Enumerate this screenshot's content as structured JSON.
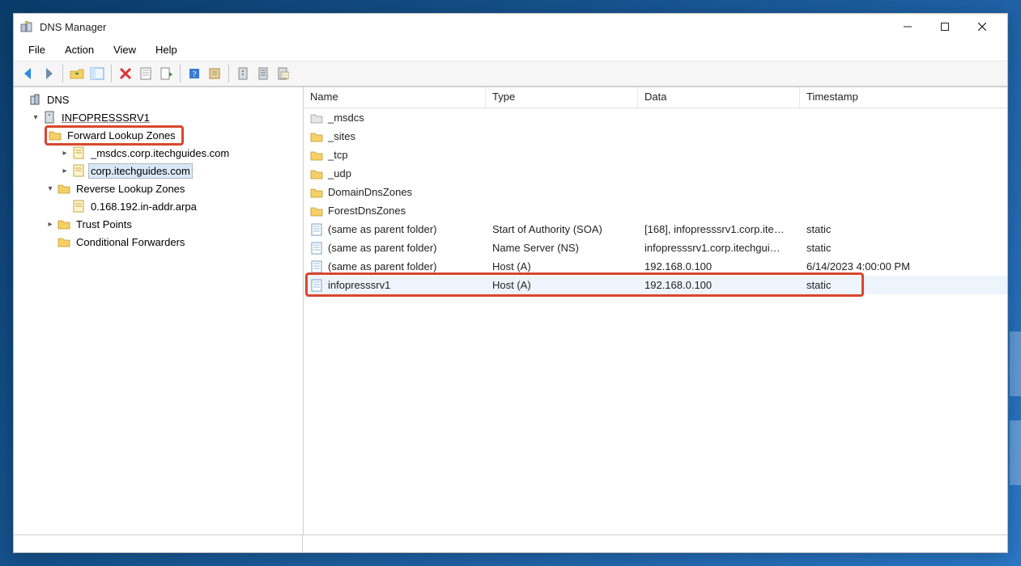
{
  "window": {
    "title": "DNS Manager"
  },
  "menu": [
    "File",
    "Action",
    "View",
    "Help"
  ],
  "tree": {
    "root_label": "DNS",
    "server_label": "INFOPRESSSRV1",
    "fwd_label": "Forward Lookup Zones",
    "fwd_children": [
      "_msdcs.corp.itechguides.com",
      "corp.itechguides.com"
    ],
    "rev_label": "Reverse Lookup Zones",
    "rev_children": [
      "0.168.192.in-addr.arpa"
    ],
    "trust_label": "Trust Points",
    "cond_label": "Conditional Forwarders"
  },
  "list": {
    "columns": [
      "Name",
      "Type",
      "Data",
      "Timestamp"
    ],
    "rows": [
      {
        "icon": "folder-gray",
        "name": "_msdcs",
        "type": "",
        "data": "",
        "ts": ""
      },
      {
        "icon": "folder",
        "name": "_sites",
        "type": "",
        "data": "",
        "ts": ""
      },
      {
        "icon": "folder",
        "name": "_tcp",
        "type": "",
        "data": "",
        "ts": ""
      },
      {
        "icon": "folder",
        "name": "_udp",
        "type": "",
        "data": "",
        "ts": ""
      },
      {
        "icon": "folder",
        "name": "DomainDnsZones",
        "type": "",
        "data": "",
        "ts": ""
      },
      {
        "icon": "folder",
        "name": "ForestDnsZones",
        "type": "",
        "data": "",
        "ts": ""
      },
      {
        "icon": "record",
        "name": "(same as parent folder)",
        "type": "Start of Authority (SOA)",
        "data": "[168], infopresssrv1.corp.ite…",
        "ts": "static"
      },
      {
        "icon": "record",
        "name": "(same as parent folder)",
        "type": "Name Server (NS)",
        "data": "infopresssrv1.corp.itechgui…",
        "ts": "static"
      },
      {
        "icon": "record",
        "name": "(same as parent folder)",
        "type": "Host (A)",
        "data": "192.168.0.100",
        "ts": "6/14/2023 4:00:00 PM"
      },
      {
        "icon": "record",
        "name": "infopresssrv1",
        "type": "Host (A)",
        "data": "192.168.0.100",
        "ts": "static",
        "selected": true
      }
    ]
  }
}
